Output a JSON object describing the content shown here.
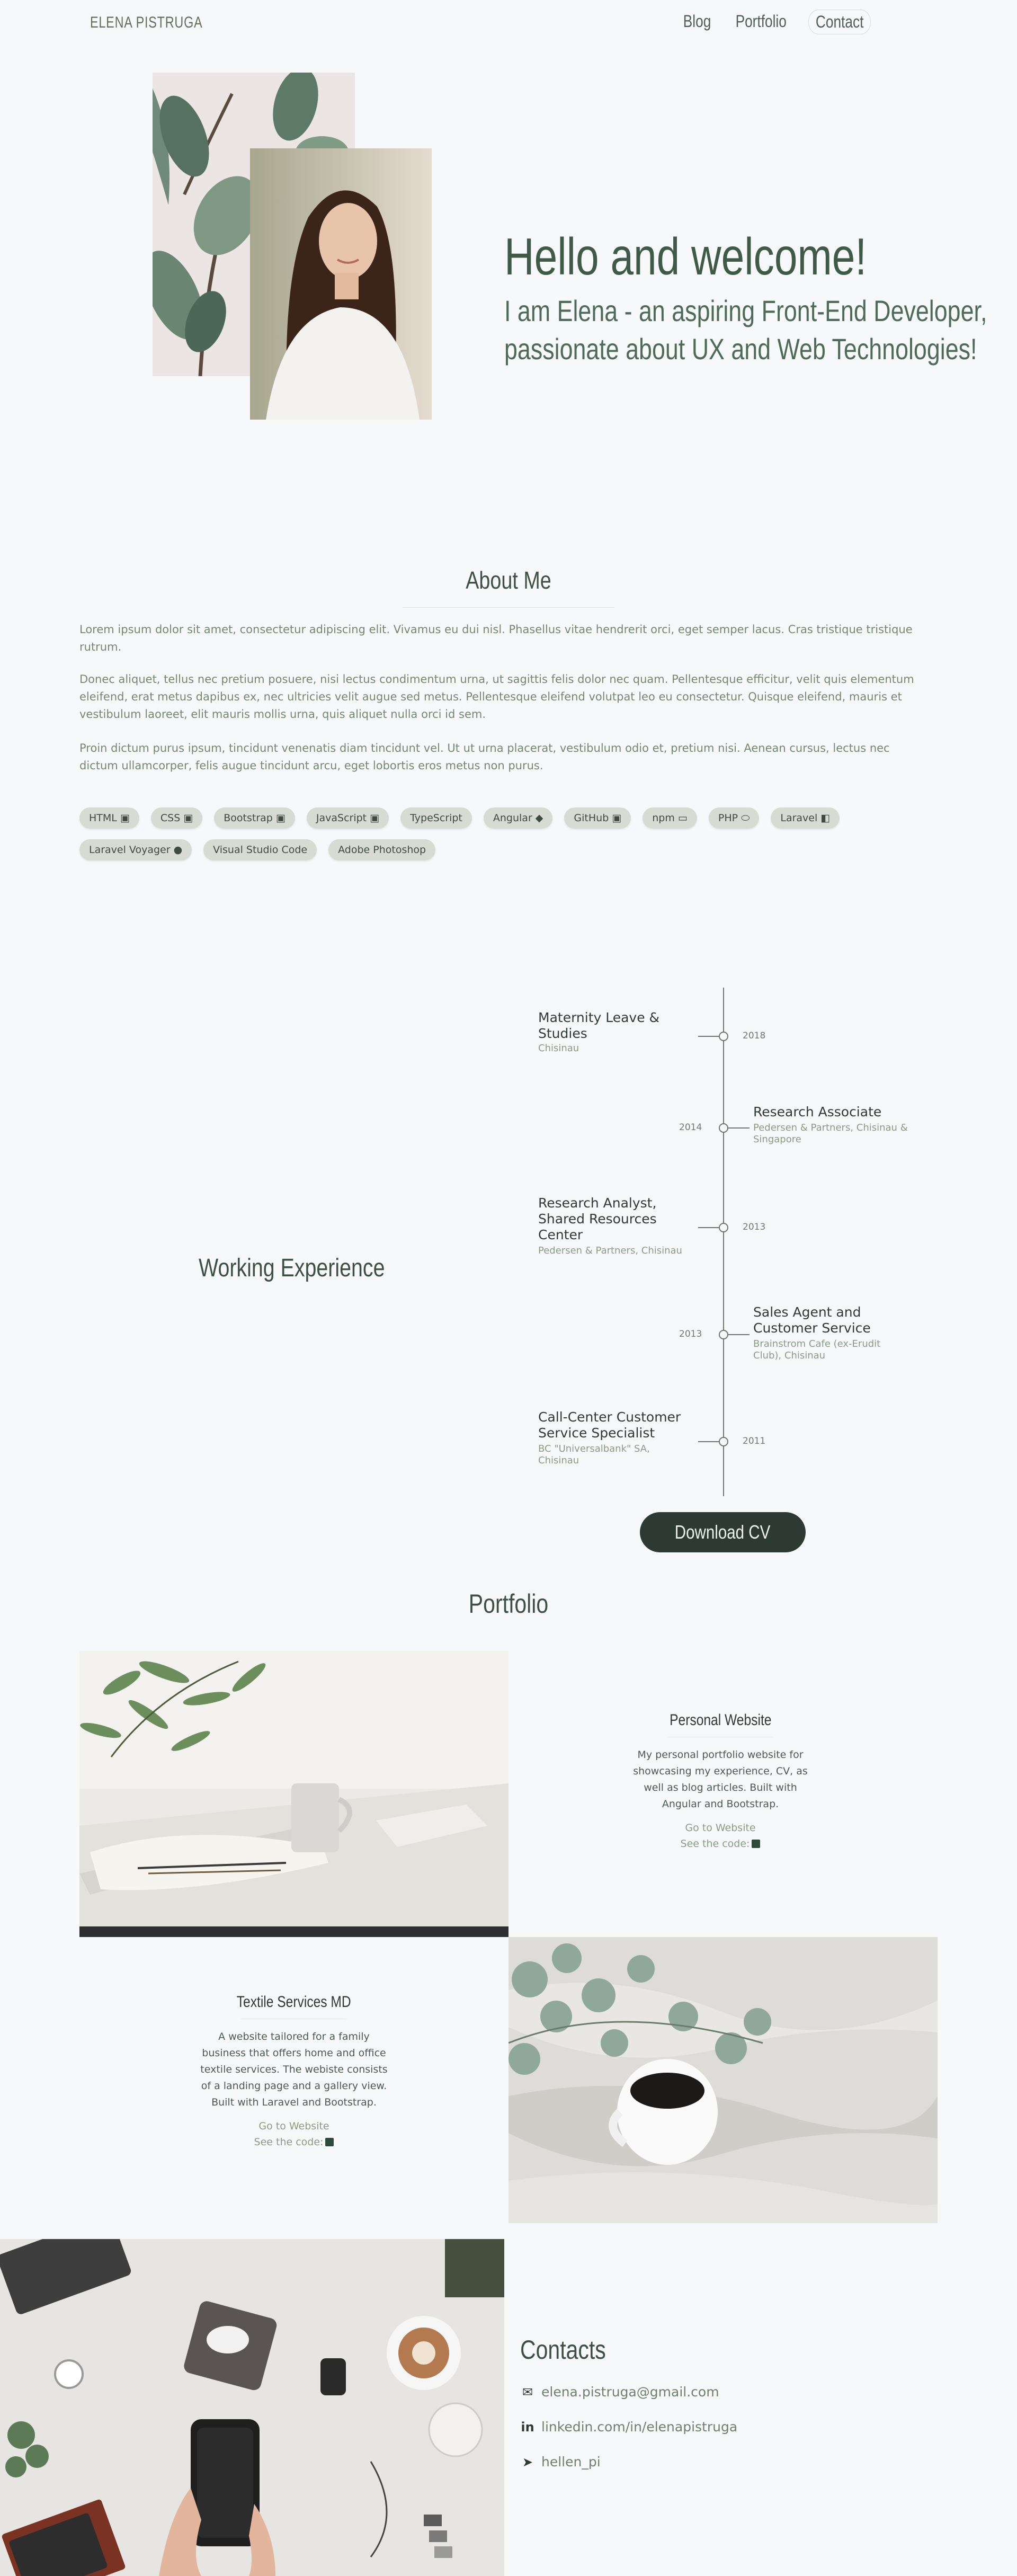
{
  "nav": {
    "brand": "ELENA PISTRUGA",
    "links": [
      "Blog",
      "Portfolio",
      "Contact"
    ]
  },
  "hero": {
    "title": "Hello and welcome!",
    "subtitle": "I am Elena - an aspiring Front-End Developer, passionate about UX and Web Technologies!"
  },
  "about": {
    "title": "About Me",
    "paragraphs": [
      "Lorem ipsum dolor sit amet, consectetur adipiscing elit. Vivamus eu dui nisl. Phasellus vitae hendrerit orci, eget semper lacus. Cras tristique tristique rutrum.",
      "Donec aliquet, tellus nec pretium posuere, nisi lectus condimentum urna, ut sagittis felis dolor nec quam. Pellentesque efficitur, velit quis elementum eleifend, erat metus dapibus ex, nec ultricies velit augue sed metus. Pellentesque eleifend volutpat leo eu consectetur. Quisque eleifend, mauris et vestibulum laoreet, elit mauris mollis urna, quis aliquet nulla orci id sem.",
      "Proin dictum purus ipsum, tincidunt venenatis diam tincidunt vel. Ut ut urna placerat, vestibulum odio et, pretium nisi. Aenean cursus, lectus nec dictum ullamcorper, felis augue tincidunt arcu, eget lobortis eros metus non purus."
    ],
    "tags": [
      "HTML",
      "CSS",
      "Bootstrap",
      "JavaScript",
      "TypeScript",
      "Angular",
      "GitHub",
      "npm",
      "PHP",
      "Laravel",
      "Laravel Voyager",
      "Visual Studio Code",
      "Adobe Photoshop"
    ]
  },
  "experience": {
    "title": "Working Experience",
    "items": [
      {
        "year": "2018",
        "role": "Maternity Leave & Studies",
        "company": "Chisinau"
      },
      {
        "year": "2014",
        "role": "Research Associate",
        "company": "Pedersen & Partners, Chisinau & Singapore"
      },
      {
        "year": "2013",
        "role": "Research Analyst, Shared Resources Center",
        "company": "Pedersen & Partners, Chisinau"
      },
      {
        "year": "2013",
        "role": "Sales Agent and Customer Service",
        "company": "Brainstrom Cafe (ex-Erudit Club), Chisinau"
      },
      {
        "year": "2011",
        "role": "Call-Center Customer Service Specialist",
        "company": "BC \"Universalbank\" SA, Chisinau"
      }
    ],
    "cv_button": "Download CV"
  },
  "portfolio": {
    "title": "Portfolio",
    "projects": [
      {
        "title": "Personal Website",
        "description": "My personal portfolio website for showcasing my experience, CV, as well as blog articles. Built with Angular and Bootstrap.",
        "link": "Go to Website",
        "code": "See the code:"
      },
      {
        "title": "Textile Services MD",
        "description": "A website tailored for a family business that offers home and office textile services. The webiste consists of a landing page and a gallery view. Built with Laravel and Bootstrap.",
        "link": "Go to Website",
        "code": "See the code:"
      }
    ]
  },
  "contacts": {
    "title": "Contacts",
    "items": [
      {
        "icon": "envelope-icon",
        "text": "elena.pistruga@gmail.com"
      },
      {
        "icon": "linkedin-icon",
        "text": "linkedin.com/in/elenapistruga"
      },
      {
        "icon": "telegram-icon",
        "text": "hellen_pi"
      }
    ]
  },
  "colors": {
    "background": "#f7f8fa",
    "heading_green": "#3f5a47",
    "tag_bg": "#d8dbd3",
    "button_dark": "#2d3a33"
  }
}
